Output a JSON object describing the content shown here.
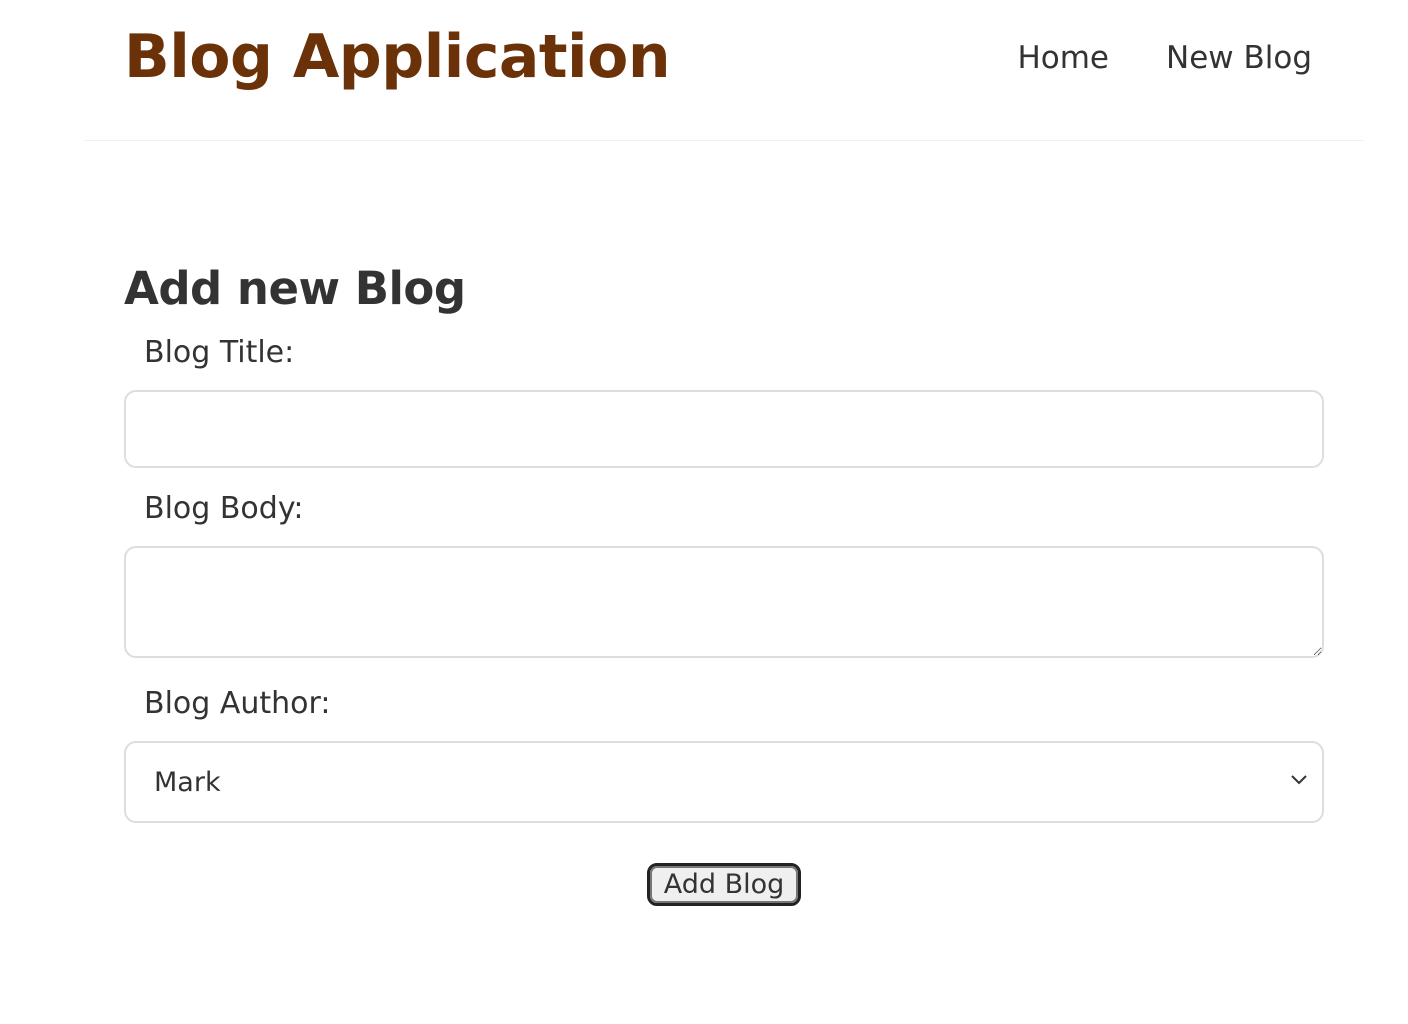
{
  "navbar": {
    "brand": "Blog Application",
    "links": [
      {
        "label": "Home"
      },
      {
        "label": "New Blog"
      }
    ]
  },
  "form": {
    "heading": "Add new Blog",
    "title_label": "Blog Title:",
    "title_value": "",
    "body_label": "Blog Body:",
    "body_value": "",
    "author_label": "Blog Author:",
    "author_selected": "Mark",
    "submit_label": "Add Blog"
  },
  "colors": {
    "brand": "#6b3108",
    "text": "#333333",
    "border": "#dddddd"
  }
}
